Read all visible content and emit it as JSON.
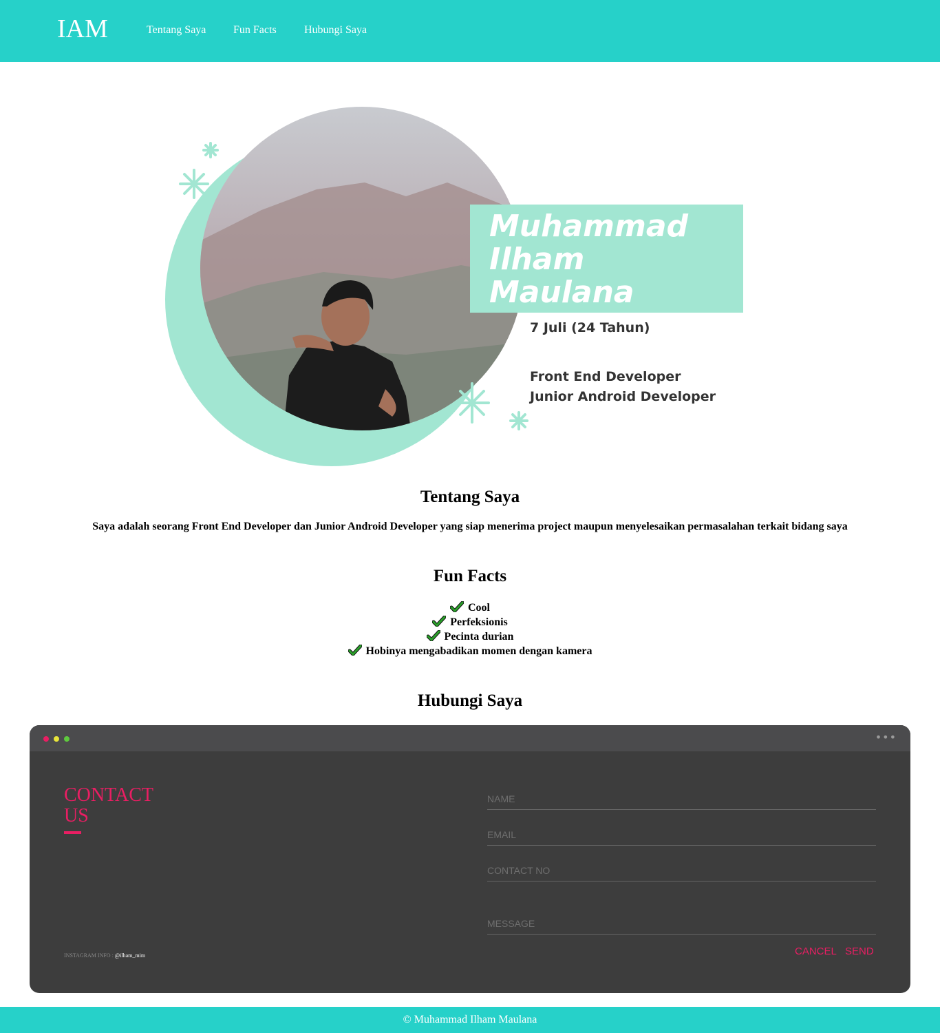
{
  "nav": {
    "brand": "IAM",
    "links": [
      "Tentang Saya",
      "Fun Facts",
      "Hubungi Saya"
    ]
  },
  "hero": {
    "name_lines": [
      "Muhammad",
      "Ilham",
      "Maulana"
    ],
    "birth": "7 Juli (24 Tahun)",
    "roles": [
      "Front End Developer",
      "Junior Android Developer"
    ]
  },
  "about": {
    "title": "Tentang Saya",
    "text": "Saya adalah seorang Front End Developer dan Junior Android Developer yang siap menerima project maupun menyelesaikan permasalahan terkait bidang saya"
  },
  "fun_facts": {
    "title": "Fun Facts",
    "items": [
      "Cool",
      "Perfeksionis",
      "Pecinta durian",
      "Hobinya mengabadikan momen dengan kamera"
    ]
  },
  "contact": {
    "title": "Hubungi Saya",
    "heading_lines": [
      "CONTACT",
      "US"
    ],
    "instagram_label": "INSTAGRAM INFO : ",
    "instagram_handle": "@ilham_mim",
    "placeholders": {
      "name": "NAME",
      "email": "EMAIL",
      "contact_no": "CONTACT NO",
      "message": "MESSAGE"
    },
    "cancel_label": "CANCEL",
    "send_label": "SEND",
    "dot_colors": [
      "#e91e63",
      "#e8e53a",
      "#5fc93e"
    ]
  },
  "footer": {
    "text": "© Muhammad Ilham Maulana"
  },
  "colors": {
    "brand": "#26d1c9",
    "accent": "#e91e63",
    "mint": "#a2e6d2"
  }
}
